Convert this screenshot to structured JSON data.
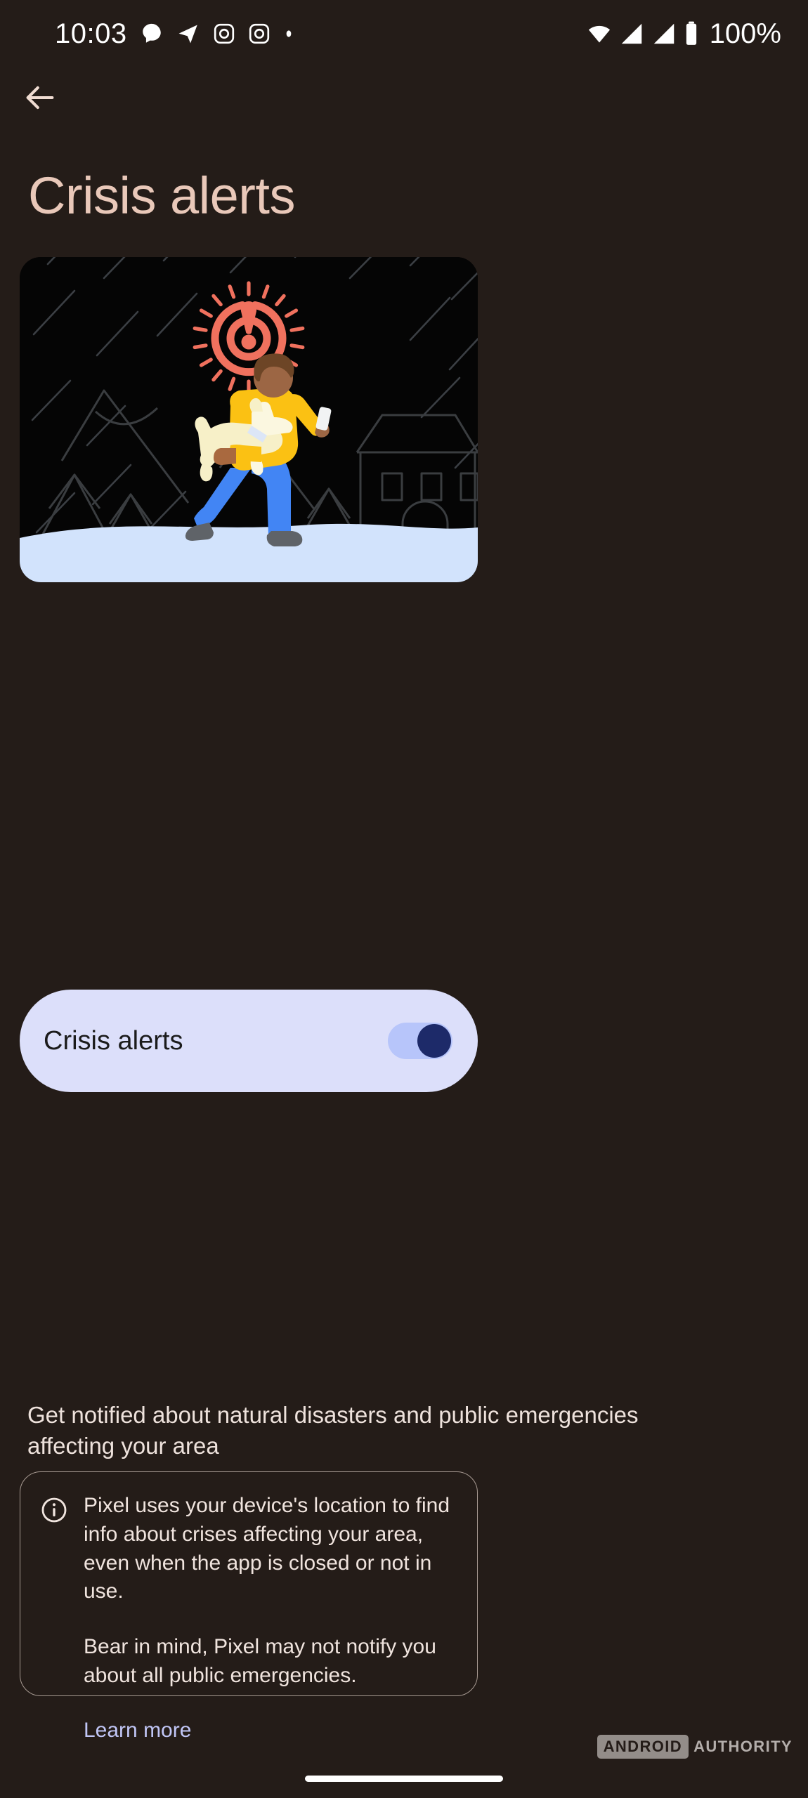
{
  "status_bar": {
    "time": "10:03",
    "battery_percent": "100%",
    "left_icons": [
      "chat-bubble-icon",
      "telegram-send-icon",
      "instagram-icon",
      "instagram-icon",
      "dot-icon"
    ],
    "right_icons": [
      "wifi-icon",
      "cellular-signal-icon",
      "cellular-signal-icon",
      "battery-icon"
    ]
  },
  "nav": {
    "back_icon": "arrow-back-icon"
  },
  "header": {
    "title": "Crisis alerts"
  },
  "illustration": {
    "name": "crisis-alert-illustration",
    "alert_icon": "crisis-alert-siren-icon",
    "scene_elements": [
      "rain-streaks",
      "mountains",
      "pine-trees",
      "house",
      "running-person-with-dog",
      "snow-ground"
    ],
    "colors": {
      "background": "#050505",
      "alert": "#f0715e",
      "shirt": "#fbc113",
      "pants": "#4285f4",
      "skin": "#9c6644",
      "hair": "#6d4526",
      "dog": "#f7f0c8",
      "ground": "#d2e3fc",
      "shoe": "#5f6368",
      "outline": "#3a3d40"
    }
  },
  "toggle_row": {
    "label": "Crisis alerts",
    "state": "on",
    "track_color": "#b7c5fa",
    "knob_color": "#1d2a69",
    "card_color": "#dcdffa"
  },
  "description": "Get notified about natural disasters and public emergencies affecting your area",
  "info_card": {
    "icon": "info-circle-icon",
    "paragraph_1": "Pixel uses your device's location to find info about crises affecting your area, even when the app is closed or not in use.",
    "paragraph_2": "Bear in mind, Pixel may not notify you about all public emergencies.",
    "link_label": "Learn more",
    "link_color": "#c1c6f6"
  },
  "watermark": {
    "badge": "ANDROID",
    "text": "AUTHORITY"
  },
  "theme": {
    "background": "#241c18",
    "title_color": "#e9c8b9",
    "body_text": "#eee2dc"
  }
}
